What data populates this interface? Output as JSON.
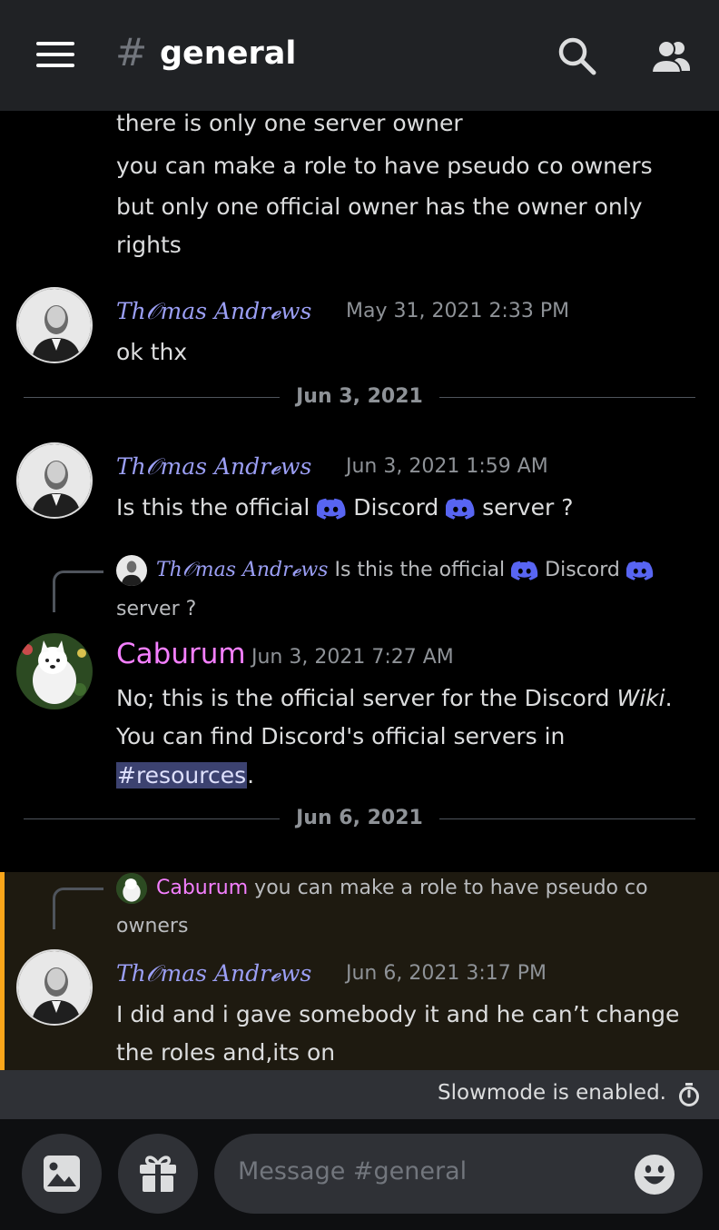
{
  "header": {
    "channel_hash": "#",
    "channel_name": "general"
  },
  "icons": {
    "menu": "hamburger-icon",
    "search": "search-icon",
    "members": "members-icon",
    "discord_logo": "discord-logo-icon",
    "slowmode": "stopwatch-icon",
    "image": "image-icon",
    "gift": "gift-icon",
    "emoji": "emoji-icon"
  },
  "colors": {
    "header_bg": "#202225",
    "thomas_name": "#9b9ff5",
    "caburum_name": "#f47fff",
    "discord_blurple": "#5865f2",
    "highlight_bar": "#faa61a",
    "mention_bg": "#3c4270"
  },
  "messages": {
    "top_lines": [
      "there is only one server owner",
      "you can make a role to have pseudo co owners",
      "but only one official owner has the owner only",
      "rights"
    ],
    "m1": {
      "author": "Th𝒪mas Andr𝓮ws",
      "timestamp": "May 31, 2021 2:33 PM",
      "text": "ok thx"
    },
    "divider1": "Jun 3, 2021",
    "m2": {
      "author": "Th𝒪mas Andr𝓮ws",
      "timestamp": "Jun 3, 2021 1:59 AM",
      "text_a": "Is this  the official",
      "text_b": "Discord",
      "text_c": "server ?"
    },
    "reply1": {
      "author": "Th𝒪mas Andr𝓮ws",
      "text_a": "Is this  the official",
      "text_b": "Discord",
      "text_c": "server ?"
    },
    "m3": {
      "author": "Caburum",
      "timestamp": "Jun 3, 2021 7:27 AM",
      "line1_a": "No; this is the official server for the Discord ",
      "line1_b": "Wiki",
      "line1_c": ".",
      "line2": "You can find Discord's official servers in",
      "mention": "#resources",
      "line3_tail": "."
    },
    "divider2": "Jun 6, 2021",
    "reply2": {
      "author": "Caburum",
      "text": "you can make a role to have pseudo co",
      "text2": "owners"
    },
    "m4": {
      "author": "Th𝒪mas Andr𝓮ws",
      "timestamp": "Jun 6, 2021 3:17 PM",
      "line1": "I did and i gave somebody it and he can’t change",
      "line2": "the roles and,its on"
    }
  },
  "slowmode": {
    "text": "Slowmode is enabled."
  },
  "composer": {
    "placeholder": "Message #general"
  }
}
